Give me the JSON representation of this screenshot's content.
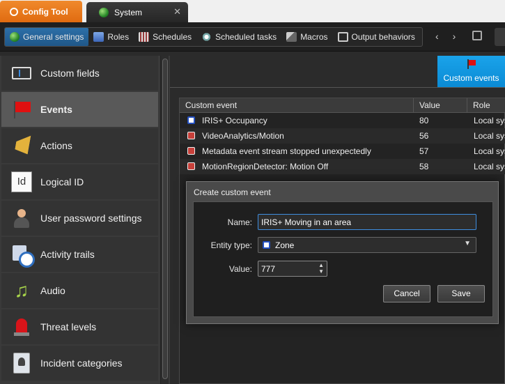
{
  "tabs": {
    "config_tool": "Config Tool",
    "system": "System",
    "close_glyph": "✕"
  },
  "toolbar": {
    "items": [
      {
        "label": "General settings",
        "icon": "globe-icon",
        "active": true
      },
      {
        "label": "Roles",
        "icon": "roles-icon"
      },
      {
        "label": "Schedules",
        "icon": "schedules-icon"
      },
      {
        "label": "Scheduled tasks",
        "icon": "scheduled-tasks-icon"
      },
      {
        "label": "Macros",
        "icon": "macros-icon"
      },
      {
        "label": "Output behaviors",
        "icon": "output-behaviors-icon"
      }
    ],
    "back_glyph": "‹",
    "forward_glyph": "›"
  },
  "sidebar": {
    "items": [
      {
        "label": "Custom fields",
        "icon": "custom-fields-icon"
      },
      {
        "label": "Events",
        "icon": "events-flag-icon",
        "selected": true
      },
      {
        "label": "Actions",
        "icon": "actions-megaphone-icon"
      },
      {
        "label": "Logical ID",
        "icon": "logical-id-icon",
        "glyph": "Id"
      },
      {
        "label": "User password settings",
        "icon": "user-icon"
      },
      {
        "label": "Activity trails",
        "icon": "activity-trails-icon"
      },
      {
        "label": "Audio",
        "icon": "audio-note-icon",
        "glyph": "♫"
      },
      {
        "label": "Threat levels",
        "icon": "threat-siren-icon"
      },
      {
        "label": "Incident categories",
        "icon": "incident-categories-icon"
      }
    ]
  },
  "panel_tab": {
    "label": "Custom events",
    "icon": "flag-icon"
  },
  "table": {
    "columns": [
      "Custom event",
      "Value",
      "Role"
    ],
    "rows": [
      {
        "event": "IRIS+ Occupancy",
        "value": "80",
        "role": "Local sys",
        "icon": "zone-icon"
      },
      {
        "event": "VideoAnalytics/Motion",
        "value": "56",
        "role": "Local sys",
        "icon": "video-icon"
      },
      {
        "event": "Metadata event stream stopped unexpectedly",
        "value": "57",
        "role": "Local sys",
        "icon": "video-icon"
      },
      {
        "event": "MotionRegionDetector: Motion Off",
        "value": "58",
        "role": "Local sys",
        "icon": "video-icon"
      }
    ]
  },
  "dialog": {
    "title": "Create custom event",
    "name_label": "Name:",
    "name_value": "IRIS+ Moving in an area",
    "entity_type_label": "Entity type:",
    "entity_type_value": "Zone",
    "value_label": "Value:",
    "value_value": "777",
    "cancel_label": "Cancel",
    "save_label": "Save"
  },
  "colors": {
    "accent": "#0a8ad4",
    "config_tab": "#e06b10",
    "active_tool": "#1f5788"
  }
}
